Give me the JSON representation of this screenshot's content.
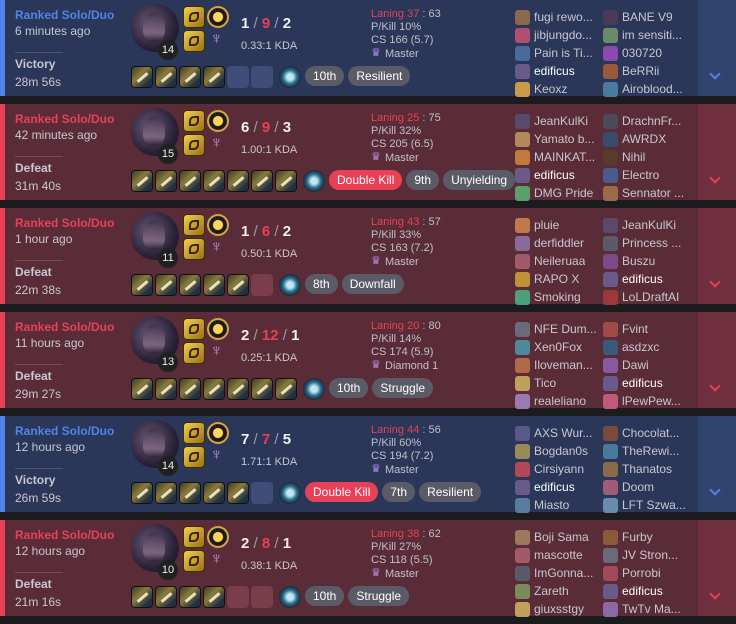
{
  "matches": [
    {
      "result_class": "victory",
      "queue": "Ranked Solo/Duo",
      "time_ago": "6 minutes ago",
      "result": "Victory",
      "duration": "28m 56s",
      "level": "14",
      "kills": "1",
      "deaths": "9",
      "assists": "2",
      "kda_ratio": "0.33:1 KDA",
      "item_slots": [
        "filled",
        "filled",
        "filled",
        "filled",
        "empty",
        "empty"
      ],
      "badges": [
        {
          "text": "10th",
          "color": "grey"
        },
        {
          "text": "Resilient",
          "color": "grey"
        }
      ],
      "laning_label": "Laning 37",
      "laning_opp": "63",
      "pkill": "P/Kill 10%",
      "cs": "CS 166 (5.7)",
      "tier": "Master",
      "team_blue": [
        {
          "name": "fugi rewo...",
          "me": false,
          "color": "#8a6a4a"
        },
        {
          "name": "jibjungdo...",
          "me": false,
          "color": "#b05070"
        },
        {
          "name": "Pain is Ti...",
          "me": false,
          "color": "#4a6a9a"
        },
        {
          "name": "edificus",
          "me": true,
          "color": "#6a5a8a"
        },
        {
          "name": "Keoxz",
          "me": false,
          "color": "#c89a4a"
        }
      ],
      "team_red": [
        {
          "name": "BANE V9",
          "me": false,
          "color": "#4a3a5a"
        },
        {
          "name": "im sensiti...",
          "me": false,
          "color": "#6a8a6a"
        },
        {
          "name": "030720",
          "me": false,
          "color": "#8a4ab0"
        },
        {
          "name": "BeRRii",
          "me": false,
          "color": "#9a5a3a"
        },
        {
          "name": "Airoblood...",
          "me": false,
          "color": "#4a7aa0"
        }
      ]
    },
    {
      "result_class": "defeat",
      "queue": "Ranked Solo/Duo",
      "time_ago": "42 minutes ago",
      "result": "Defeat",
      "duration": "31m 40s",
      "level": "15",
      "kills": "6",
      "deaths": "9",
      "assists": "3",
      "kda_ratio": "1.00:1 KDA",
      "item_slots": [
        "filled",
        "filled",
        "filled",
        "filled",
        "filled",
        "filled",
        "filled"
      ],
      "badges": [
        {
          "text": "Double Kill",
          "color": "red"
        },
        {
          "text": "9th",
          "color": "grey"
        },
        {
          "text": "Unyielding",
          "color": "grey"
        }
      ],
      "laning_label": "Laning 25",
      "laning_opp": "75",
      "pkill": "P/Kill 32%",
      "cs": "CS 205 (6.5)",
      "tier": "Master",
      "team_blue": [
        {
          "name": "JeanKulKi",
          "me": false,
          "color": "#5a4a6a"
        },
        {
          "name": "Yamato b...",
          "me": false,
          "color": "#b08a5a"
        },
        {
          "name": "MAINKAT...",
          "me": false,
          "color": "#c07a3a"
        },
        {
          "name": "edificus",
          "me": true,
          "color": "#6a5a8a"
        },
        {
          "name": "DMG Pride",
          "me": false,
          "color": "#5aa06a"
        }
      ],
      "team_red": [
        {
          "name": "DrachnFr...",
          "me": false,
          "color": "#4a4a5a"
        },
        {
          "name": "AWRDX",
          "me": false,
          "color": "#3a4a6a"
        },
        {
          "name": "Nihil",
          "me": false,
          "color": "#5a3a2a"
        },
        {
          "name": "Electro",
          "me": false,
          "color": "#4a5a8a"
        },
        {
          "name": "Sennator ...",
          "me": false,
          "color": "#9a6a4a"
        }
      ]
    },
    {
      "result_class": "defeat",
      "queue": "Ranked Solo/Duo",
      "time_ago": "1 hour ago",
      "result": "Defeat",
      "duration": "22m 38s",
      "level": "11",
      "kills": "1",
      "deaths": "6",
      "assists": "2",
      "kda_ratio": "0.50:1 KDA",
      "item_slots": [
        "filled",
        "filled",
        "filled",
        "filled",
        "filled",
        "empty"
      ],
      "badges": [
        {
          "text": "8th",
          "color": "grey"
        },
        {
          "text": "Downfall",
          "color": "grey"
        }
      ],
      "laning_label": "Laning 43",
      "laning_opp": "57",
      "pkill": "P/Kill 33%",
      "cs": "CS 163 (7.2)",
      "tier": "Master",
      "team_blue": [
        {
          "name": "pluie",
          "me": false,
          "color": "#c07a4a"
        },
        {
          "name": "derfiddler",
          "me": false,
          "color": "#8a6a9a"
        },
        {
          "name": "Neileruaa",
          "me": false,
          "color": "#a05a6a"
        },
        {
          "name": "RAPO X",
          "me": false,
          "color": "#c0903a"
        },
        {
          "name": "Smoking",
          "me": false,
          "color": "#4aa07a"
        }
      ],
      "team_red": [
        {
          "name": "JeanKulKi",
          "me": false,
          "color": "#5a4a6a"
        },
        {
          "name": "Princess ...",
          "me": false,
          "color": "#5a5a6a"
        },
        {
          "name": "Buszu",
          "me": false,
          "color": "#7a4a8a"
        },
        {
          "name": "edificus",
          "me": true,
          "color": "#6a5a8a"
        },
        {
          "name": "LoLDraftAI",
          "me": false,
          "color": "#9a3a3a"
        }
      ]
    },
    {
      "result_class": "defeat",
      "queue": "Ranked Solo/Duo",
      "time_ago": "11 hours ago",
      "result": "Defeat",
      "duration": "29m 27s",
      "level": "13",
      "kills": "2",
      "deaths": "12",
      "assists": "1",
      "kda_ratio": "0.25:1 KDA",
      "item_slots": [
        "filled",
        "filled",
        "filled",
        "filled",
        "filled",
        "filled",
        "filled"
      ],
      "badges": [
        {
          "text": "10th",
          "color": "grey"
        },
        {
          "text": "Struggle",
          "color": "grey"
        }
      ],
      "laning_label": "Laning 20",
      "laning_opp": "80",
      "pkill": "P/Kill 14%",
      "cs": "CS 174 (5.9)",
      "tier": "Diamond 1",
      "team_blue": [
        {
          "name": "NFE Dum...",
          "me": false,
          "color": "#6a6a7a"
        },
        {
          "name": "Xen0Fox",
          "me": false,
          "color": "#4a8a9a"
        },
        {
          "name": "Iloveman...",
          "me": false,
          "color": "#b06a4a"
        },
        {
          "name": "Tico",
          "me": false,
          "color": "#c0a05a"
        },
        {
          "name": "realeliano",
          "me": false,
          "color": "#9a7ab0"
        }
      ],
      "team_red": [
        {
          "name": "Fvint",
          "me": false,
          "color": "#a04a4a"
        },
        {
          "name": "asdzxc",
          "me": false,
          "color": "#3a5a7a"
        },
        {
          "name": "Dawi",
          "me": false,
          "color": "#8a5aa0"
        },
        {
          "name": "edificus",
          "me": true,
          "color": "#6a5a8a"
        },
        {
          "name": "lPewPew...",
          "me": false,
          "color": "#c05a7a"
        }
      ]
    },
    {
      "result_class": "victory",
      "queue": "Ranked Solo/Duo",
      "time_ago": "12 hours ago",
      "result": "Victory",
      "duration": "26m 59s",
      "level": "14",
      "kills": "7",
      "deaths": "7",
      "assists": "5",
      "kda_ratio": "1.71:1 KDA",
      "item_slots": [
        "filled",
        "filled",
        "filled",
        "filled",
        "filled",
        "empty"
      ],
      "badges": [
        {
          "text": "Double Kill",
          "color": "red"
        },
        {
          "text": "7th",
          "color": "grey"
        },
        {
          "text": "Resilient",
          "color": "grey"
        }
      ],
      "laning_label": "Laning 44",
      "laning_opp": "56",
      "pkill": "P/Kill 60%",
      "cs": "CS 194 (7.2)",
      "tier": "Master",
      "team_blue": [
        {
          "name": "AXS Wur...",
          "me": false,
          "color": "#5a5a8a"
        },
        {
          "name": "Bogdan0s",
          "me": false,
          "color": "#9a8a5a"
        },
        {
          "name": "Cirsiyann",
          "me": false,
          "color": "#b04a5a"
        },
        {
          "name": "edificus",
          "me": true,
          "color": "#6a5a8a"
        },
        {
          "name": "Miasto",
          "me": false,
          "color": "#5a7aa0"
        }
      ],
      "team_red": [
        {
          "name": "Chocolat...",
          "me": false,
          "color": "#7a4a3a"
        },
        {
          "name": "TheRewi...",
          "me": false,
          "color": "#4a7a9a"
        },
        {
          "name": "Thanatos",
          "me": false,
          "color": "#8a6a4a"
        },
        {
          "name": "Doom",
          "me": false,
          "color": "#a05a7a"
        },
        {
          "name": "LFT Szwa...",
          "me": false,
          "color": "#6a8ab0"
        }
      ]
    },
    {
      "result_class": "defeat",
      "queue": "Ranked Solo/Duo",
      "time_ago": "12 hours ago",
      "result": "Defeat",
      "duration": "21m 16s",
      "level": "10",
      "kills": "2",
      "deaths": "8",
      "assists": "1",
      "kda_ratio": "0.38:1 KDA",
      "item_slots": [
        "filled",
        "filled",
        "filled",
        "filled",
        "empty",
        "empty"
      ],
      "badges": [
        {
          "text": "10th",
          "color": "grey"
        },
        {
          "text": "Struggle",
          "color": "grey"
        }
      ],
      "laning_label": "Laning 38",
      "laning_opp": "62",
      "pkill": "P/Kill 27%",
      "cs": "CS 118 (5.5)",
      "tier": "Master",
      "team_blue": [
        {
          "name": "Boji Sama",
          "me": false,
          "color": "#9a7a5a"
        },
        {
          "name": "mascotte",
          "me": false,
          "color": "#a05a6a"
        },
        {
          "name": "ImGonna...",
          "me": false,
          "color": "#5a5a6a"
        },
        {
          "name": "Zareth",
          "me": false,
          "color": "#7a8a5a"
        },
        {
          "name": "giuxsstgy",
          "me": false,
          "color": "#c0a05a"
        }
      ],
      "team_red": [
        {
          "name": "Furby",
          "me": false,
          "color": "#8a5a3a"
        },
        {
          "name": "JV Stron...",
          "me": false,
          "color": "#6a6a7a"
        },
        {
          "name": "Porrobi",
          "me": false,
          "color": "#a04a5a"
        },
        {
          "name": "edificus",
          "me": true,
          "color": "#6a5a8a"
        },
        {
          "name": "TwTv Ma...",
          "me": false,
          "color": "#8a6aa0"
        }
      ]
    }
  ]
}
